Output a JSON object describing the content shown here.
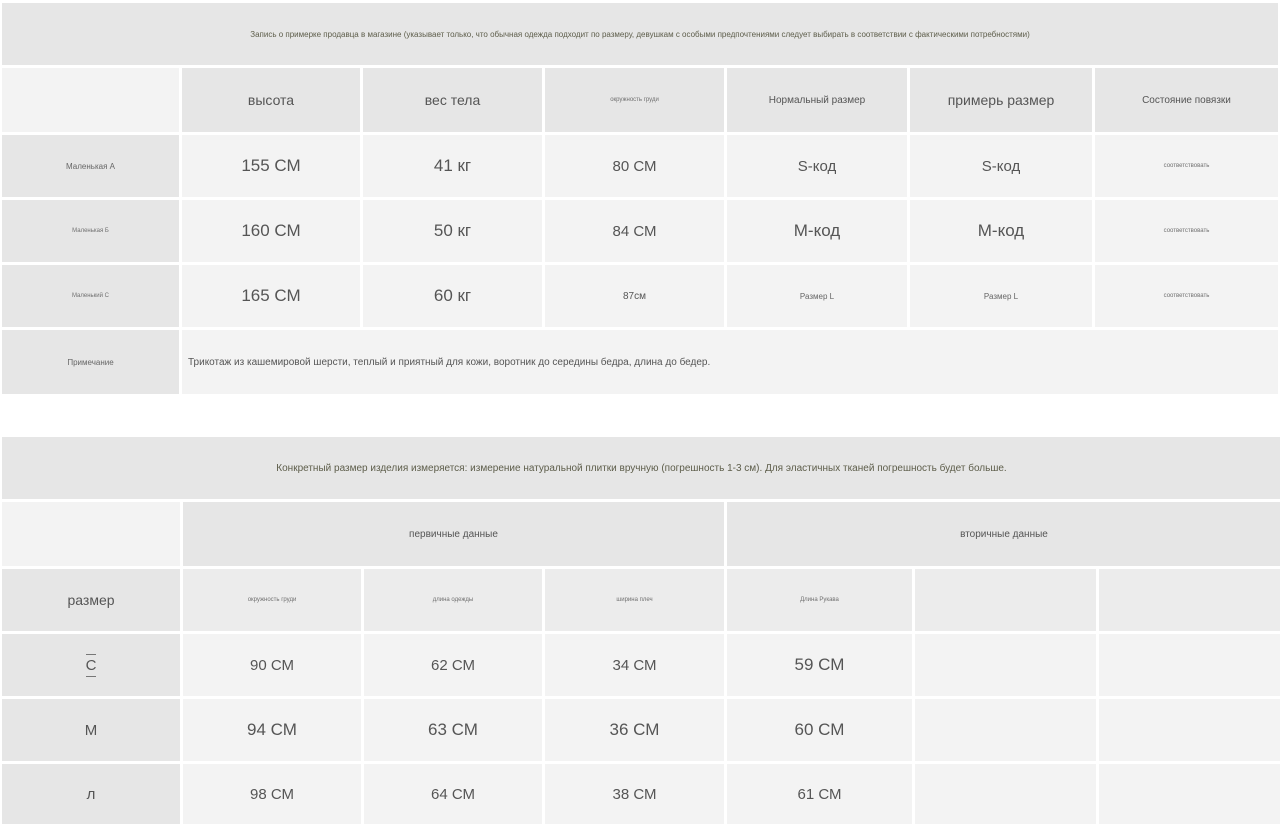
{
  "fitting": {
    "banner": "Запись о примерке продавца в магазине (указывает только, что обычная одежда подходит по размеру, девушкам с особыми предпочтениями следует выбирать в соответствии с фактическими потребностями)",
    "headers": [
      "высота",
      "вес тела",
      "окружность груди",
      "Нормальный размер",
      "примерь размер",
      "Состояние повязки"
    ],
    "rows": [
      {
        "label": "Маленькая А",
        "height": "155 СМ",
        "weight": "41 кг",
        "bust": "80 СМ",
        "normal": "S-код",
        "tried": "S-код",
        "fit": "соответствовать"
      },
      {
        "label": "Маленькая Б",
        "height": "160 СМ",
        "weight": "50 кг",
        "bust": "84 СМ",
        "normal": "М-код",
        "tried": "М-код",
        "fit": "соответствовать"
      },
      {
        "label": "Маленький С",
        "height": "165 СМ",
        "weight": "60 кг",
        "bust": "87см",
        "normal": "Размер L",
        "tried": "Размер L",
        "fit": "соответствовать"
      }
    ],
    "note_label": "Примечание",
    "note_text": "Трикотаж из кашемировой шерсти, теплый и приятный для кожи, воротник до середины бедра, длина до бедер."
  },
  "sizes": {
    "banner": "Конкретный размер изделия измеряется: измерение натуральной плитки вручную (погрешность 1-3 см). Для эластичных тканей погрешность будет больше.",
    "group_primary": "первичные данные",
    "group_secondary": "вторичные данные",
    "size_label": "размер",
    "headers": [
      "окружность груди",
      "длина одежды",
      "ширина плеч",
      "Длина Рукава"
    ],
    "rows": [
      {
        "size": "С",
        "bust": "90 СМ",
        "length": "62 СМ",
        "shoulder": "34 СМ",
        "sleeve": "59 СМ"
      },
      {
        "size": "М",
        "bust": "94 СМ",
        "length": "63 СМ",
        "shoulder": "36 СМ",
        "sleeve": "60 СМ"
      },
      {
        "size": "л",
        "bust": "98 СМ",
        "length": "64 СМ",
        "shoulder": "38 СМ",
        "sleeve": "61 СМ"
      }
    ]
  }
}
